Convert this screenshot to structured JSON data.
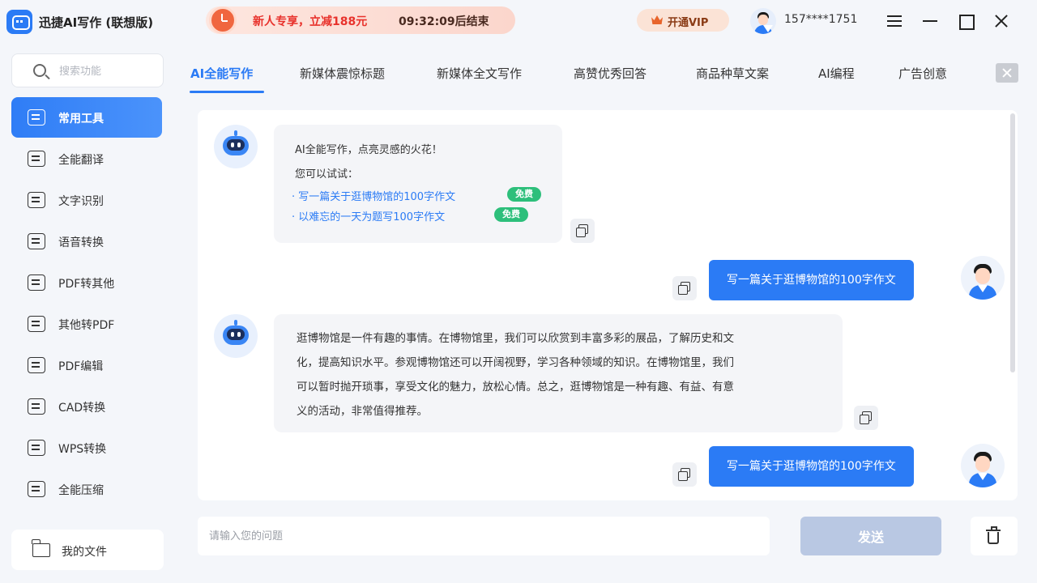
{
  "app": {
    "title": "迅捷AI写作 (联想版)"
  },
  "promo": {
    "text": "新人专享，立减188元",
    "timer": "09:32:09后结束"
  },
  "vip": {
    "label": "开通VIP"
  },
  "user": {
    "phone": "157****1751"
  },
  "search": {
    "placeholder": "搜索功能"
  },
  "sidebar": {
    "items": [
      {
        "label": "常用工具",
        "icon": "toolbox-icon",
        "active": true
      },
      {
        "label": "全能翻译",
        "icon": "translate-icon"
      },
      {
        "label": "文字识别",
        "icon": "text-recognition-icon"
      },
      {
        "label": "语音转换",
        "icon": "voice-icon"
      },
      {
        "label": "PDF转其他",
        "icon": "pdf-convert-icon"
      },
      {
        "label": "其他转PDF",
        "icon": "to-pdf-icon"
      },
      {
        "label": "PDF编辑",
        "icon": "pdf-edit-icon"
      },
      {
        "label": "CAD转换",
        "icon": "cad-icon"
      },
      {
        "label": "WPS转换",
        "icon": "wps-icon"
      },
      {
        "label": "全能压缩",
        "icon": "compress-icon"
      }
    ],
    "my_files": "我的文件"
  },
  "tabs": [
    {
      "label": "AI全能写作",
      "active": true
    },
    {
      "label": "新媒体震惊标题"
    },
    {
      "label": "新媒体全文写作"
    },
    {
      "label": "高赞优秀回答"
    },
    {
      "label": "商品种草文案"
    },
    {
      "label": "AI编程"
    },
    {
      "label": "广告创意"
    }
  ],
  "chat": {
    "welcome": {
      "line1": "AI全能写作，点亮灵感的火花！",
      "line2": "您可以试试：",
      "suggestions": [
        {
          "text": "· 写一篇关于逛博物馆的100字作文",
          "badge": "免费"
        },
        {
          "text": "· 以难忘的一天为题写100字作文",
          "badge": "免费"
        }
      ]
    },
    "user_message_1": "写一篇关于逛博物馆的100字作文",
    "answer_lines": [
      "逛博物馆是一件有趣的事情。在博物馆里，我们可以欣赏到丰富多彩的展品，了解历史和文",
      "化，提高知识水平。参观博物馆还可以开阔视野，学习各种领域的知识。在博物馆里，我们",
      "可以暂时抛开琐事，享受文化的魅力，放松心情。总之，逛博物馆是一种有趣、有益、有意",
      "义的活动，非常值得推荐。"
    ],
    "user_message_2": "写一篇关于逛博物馆的100字作文"
  },
  "input": {
    "placeholder": "请输入您的问题",
    "send_label": "发送"
  },
  "colors": {
    "accent": "#2b7bf5",
    "free_badge": "#2dbf7b",
    "promo_text": "#e8322c"
  }
}
